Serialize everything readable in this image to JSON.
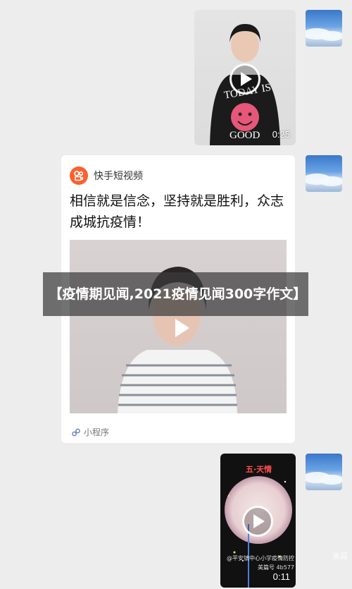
{
  "messages": [
    {
      "type": "video",
      "duration": "0:25",
      "shirt_text_top": "TODAY IS",
      "shirt_text_bottom": "GOOD"
    },
    {
      "type": "mini_program_card",
      "app_name": "快手短视频",
      "title": "相信就是信念，坚持就是胜利，众志成城抗疫情！",
      "footer_label": "小程序"
    },
    {
      "type": "video",
      "duration": "0:11",
      "banner_text": "五·天情",
      "watermark_line1": "@平安镇中心小学疫情防控",
      "watermark_line2": "美篇号 4b577"
    }
  ],
  "overlay_title": "【疫情期见闻,2021疫情见闻300字作文】",
  "corner_watermark": "美篇",
  "colors": {
    "background": "#ededed",
    "kuaishou_orange": "#fe5f2d",
    "overlay": "rgba(60,60,60,0.72)"
  }
}
